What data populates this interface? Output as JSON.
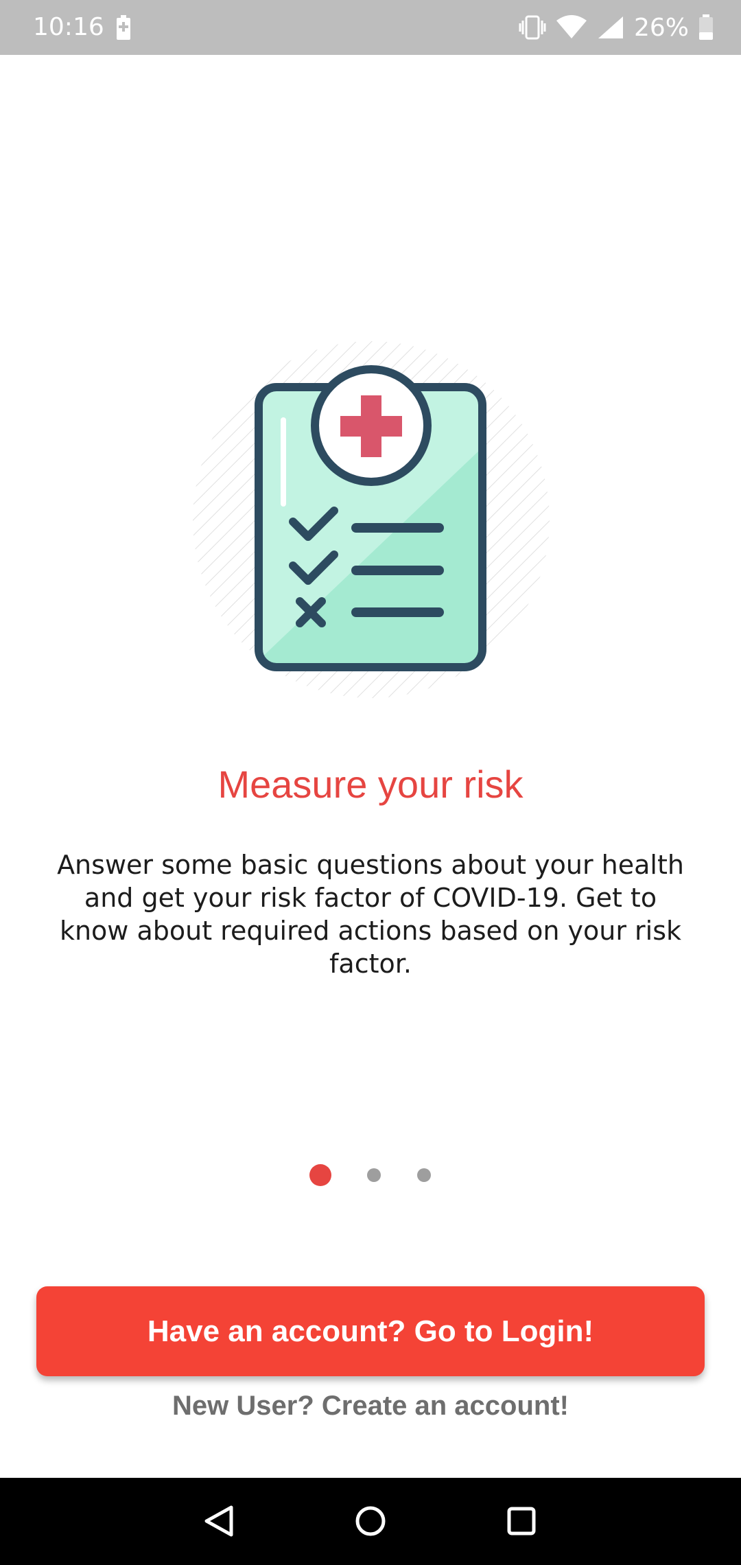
{
  "status_bar": {
    "time": "10:16",
    "battery_percent": "26%",
    "icons": [
      "battery-charging-icon",
      "vibrate-icon",
      "wifi-icon",
      "cell-signal-icon",
      "battery-icon"
    ]
  },
  "onboarding": {
    "illustration_icon": "medical-checklist-icon",
    "title": "Measure your risk",
    "description": "Answer some basic questions about your health and get your risk factor of COVID-19. Get to know about required actions based on your risk factor.",
    "page_indicator": {
      "current": 1,
      "total": 3
    }
  },
  "actions": {
    "login_label": "Have an account? Go to Login!",
    "signup_label": "New User? Create an account!"
  },
  "colors": {
    "accent": "#f44336",
    "title": "#e64541",
    "status_bar": "#bdbdbd",
    "illustration_fill": "#a4ead1",
    "illustration_stroke": "#2d4b60",
    "cross": "#d9566b"
  },
  "nav_bar": {
    "icons": [
      "back-icon",
      "home-icon",
      "recents-icon"
    ]
  }
}
